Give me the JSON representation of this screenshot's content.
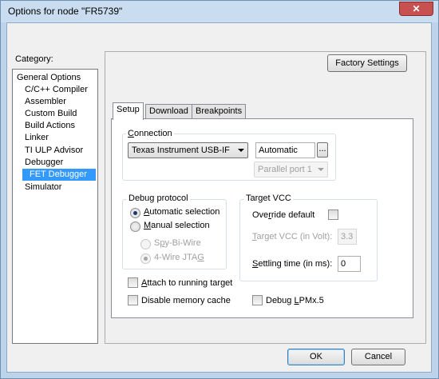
{
  "window": {
    "title": "Options for node \"FR5739\"",
    "close_glyph": "✕"
  },
  "category": {
    "label": "Category:",
    "items": [
      {
        "label": "General Options",
        "indent": false,
        "selected": false
      },
      {
        "label": "C/C++ Compiler",
        "indent": true,
        "selected": false
      },
      {
        "label": "Assembler",
        "indent": true,
        "selected": false
      },
      {
        "label": "Custom Build",
        "indent": true,
        "selected": false
      },
      {
        "label": "Build Actions",
        "indent": true,
        "selected": false
      },
      {
        "label": "Linker",
        "indent": true,
        "selected": false
      },
      {
        "label": "TI ULP Advisor",
        "indent": true,
        "selected": false
      },
      {
        "label": "Debugger",
        "indent": true,
        "selected": false
      },
      {
        "label": "FET Debugger",
        "indent": true,
        "selected": true
      },
      {
        "label": "Simulator",
        "indent": true,
        "selected": false
      }
    ]
  },
  "factory_settings_label": "Factory Settings",
  "tabs": [
    {
      "label": "Setup",
      "active": true
    },
    {
      "label": "Download",
      "active": false
    },
    {
      "label": "Breakpoints",
      "active": false
    }
  ],
  "connection": {
    "group_label": "Connection",
    "interface_value": "Texas Instrument USB-IF",
    "port_value": "Automatic",
    "browse_label": "...",
    "parallel_value": "Parallel port 1"
  },
  "debug_protocol": {
    "group_label": "Debug protocol",
    "automatic_label": "Automatic selection",
    "manual_label": "Manual selection",
    "spy_bi_wire_label": "Spy-Bi-Wire",
    "four_wire_label": "4-Wire JTAG"
  },
  "target_vcc": {
    "group_label": "Target VCC",
    "override_label": "Override default",
    "target_vcc_label": "Target VCC (in Volt):",
    "target_vcc_value": "3.3",
    "settling_label": "Settling time (in ms):",
    "settling_value": "0"
  },
  "options": {
    "attach_label": "Attach to running target",
    "disable_cache_label": "Disable memory cache",
    "debug_lpm_label": "Debug LPMx.5"
  },
  "footer": {
    "ok_label": "OK",
    "cancel_label": "Cancel"
  },
  "colors": {
    "selection": "#3399ff",
    "frame": "#bcd3ea",
    "close_button": "#c75050"
  }
}
